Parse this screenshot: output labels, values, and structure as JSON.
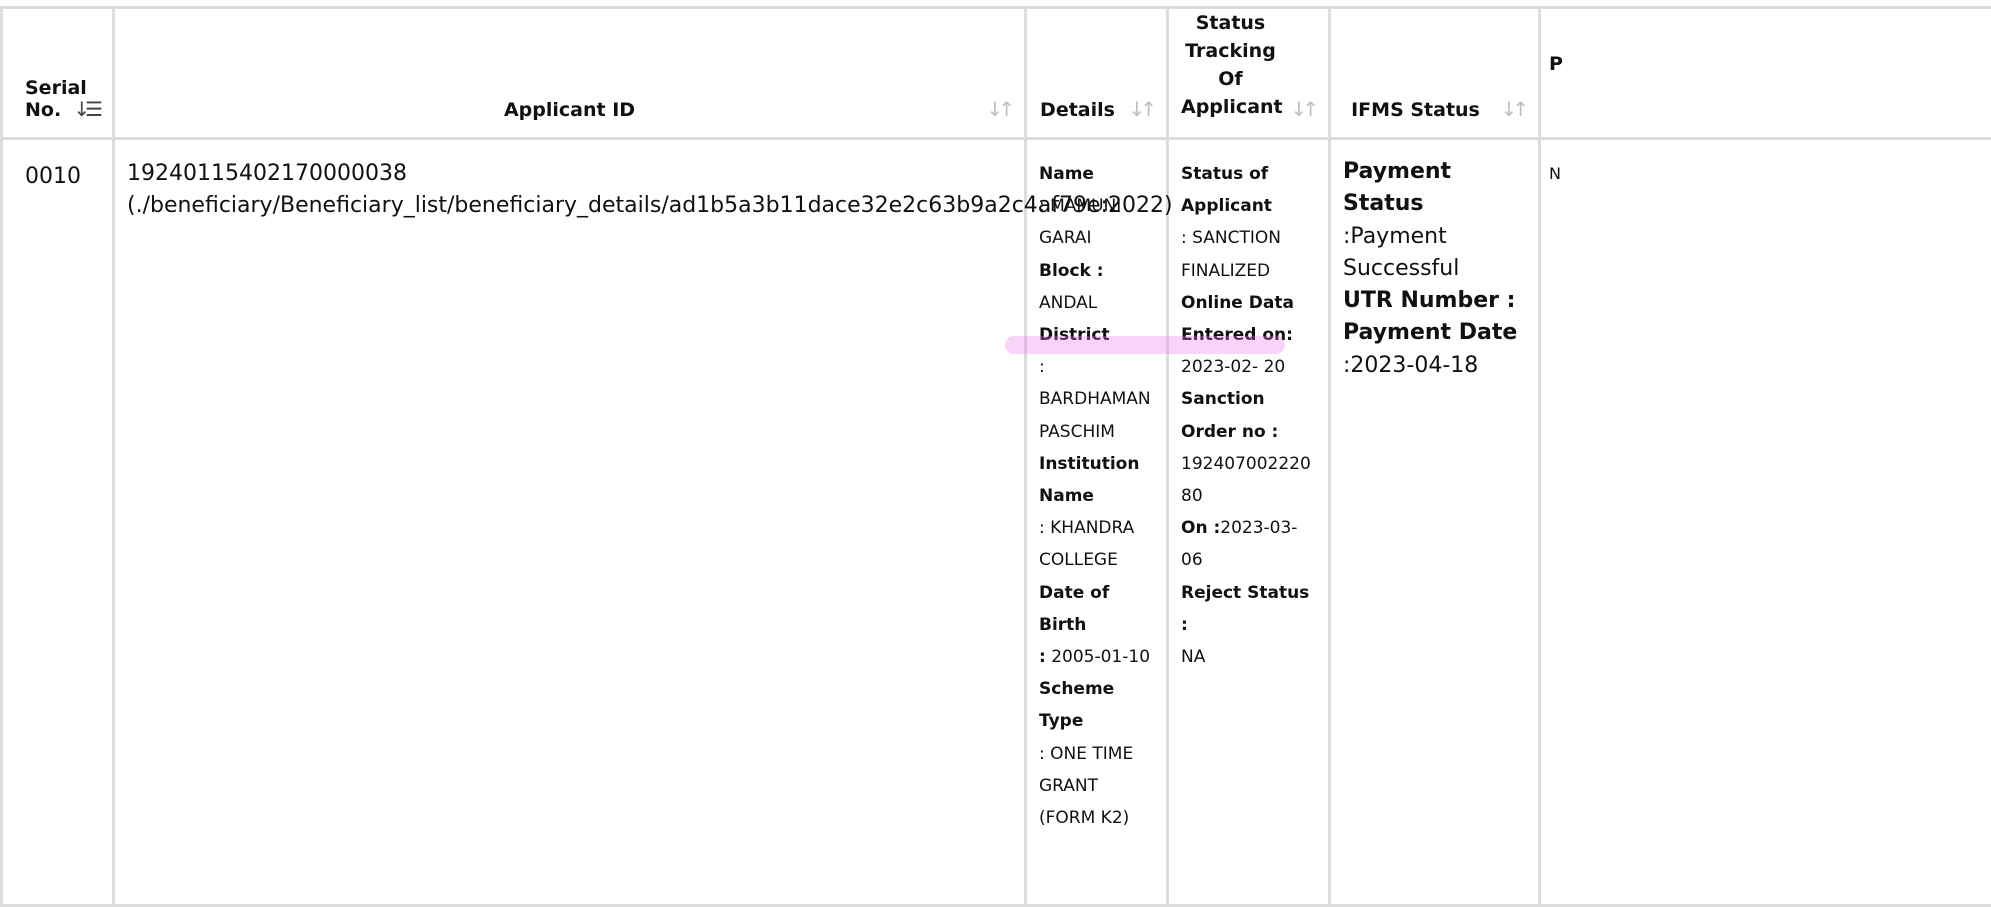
{
  "headers": {
    "serial": "Serial No.",
    "applicant_id": "Applicant ID",
    "details": "Details",
    "status_tracking": "Status Tracking Of Applicant",
    "ifms_status": "IFMS Status",
    "next_col_partial": "P"
  },
  "row": {
    "serial": "0010",
    "applicant_id": "19240115402170000038",
    "applicant_link": "(./beneficiary/Beneficiary_list/beneficiary_details/ad1b5a3b11dace32e2c63b9a2c4af79e:2022)",
    "details": {
      "name_label": "Name",
      "name_value": ": MAMUNI GARAI",
      "block_label": "Block :",
      "block_value": " ANDAL",
      "district_label": "District",
      "district_value": ": BARDHAMAN PASCHIM",
      "institution_label": "Institution Name",
      "institution_value": ": KHANDRA COLLEGE",
      "dob_label": "Date of Birth",
      "dob_value": "2005-01-10",
      "scheme_label": "Scheme Type",
      "scheme_value": ": ONE TIME GRANT (FORM K2)"
    },
    "status": {
      "status_label": "Status of Applicant",
      "status_value": ": SANCTION FINALIZED",
      "online_label": "Online Data Entered on:",
      "online_value": "2023-02- 20",
      "sanction_label": "Sanction Order no  :",
      "sanction_value": "19240700222080",
      "on_label": "On :",
      "on_value": "2023-03-06",
      "reject_label": "Reject Status :",
      "reject_value": "NA"
    },
    "ifms": {
      "payment_status_label": "Payment Status",
      "payment_status_value": ":Payment Successful",
      "utr_label": "UTR Number :",
      "payment_date_label": "Payment Date",
      "payment_date_value": ":2023-04-18"
    },
    "next_col_partial": "N"
  }
}
